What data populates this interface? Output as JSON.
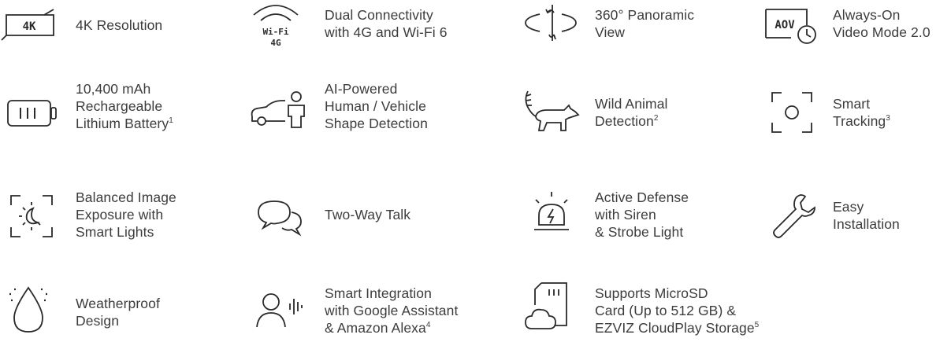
{
  "features": {
    "f1": {
      "icon": "4k-display-icon",
      "badge": "4K",
      "lines": [
        "4K Resolution"
      ]
    },
    "f2": {
      "icon": "wifi-4g-icon",
      "badge_top": "Wi-Fi",
      "badge_bottom": "4G",
      "lines": [
        "Dual Connectivity",
        "with 4G and Wi-Fi 6"
      ]
    },
    "f3": {
      "icon": "panorama-360-icon",
      "lines": [
        "360° Panoramic",
        "View"
      ]
    },
    "f4": {
      "icon": "aov-clock-icon",
      "badge": "AOV",
      "lines": [
        "Always-On",
        "Video Mode 2.0"
      ]
    },
    "f5": {
      "icon": "battery-icon",
      "lines": [
        "10,400 mAh",
        "Rechargeable",
        "Lithium Battery"
      ],
      "sup": "1"
    },
    "f6": {
      "icon": "car-person-icon",
      "lines": [
        "AI-Powered",
        "Human / Vehicle",
        "Shape Detection"
      ]
    },
    "f7": {
      "icon": "raccoon-icon",
      "lines": [
        "Wild Animal",
        "Detection"
      ],
      "sup": "2"
    },
    "f8": {
      "icon": "focus-frame-icon",
      "lines": [
        "Smart",
        "Tracking"
      ],
      "sup": "3"
    },
    "f9": {
      "icon": "sun-moon-frame-icon",
      "lines": [
        "Balanced Image",
        "Exposure with",
        "Smart Lights"
      ]
    },
    "f10": {
      "icon": "chat-bubbles-icon",
      "lines": [
        "Two-Way Talk"
      ]
    },
    "f11": {
      "icon": "siren-icon",
      "lines": [
        "Active Defense",
        "with Siren",
        "& Strobe Light"
      ]
    },
    "f12": {
      "icon": "wrench-icon",
      "lines": [
        "Easy",
        "Installation"
      ]
    },
    "f13": {
      "icon": "waterdrop-icon",
      "lines": [
        "Weatherproof",
        "Design"
      ]
    },
    "f14": {
      "icon": "voice-assistant-icon",
      "lines": [
        "Smart Integration",
        "with Google Assistant",
        "& Amazon Alexa"
      ],
      "sup": "4"
    },
    "f15": {
      "icon": "sdcard-cloud-icon",
      "lines": [
        "Supports MicroSD",
        "Card (Up to 512 GB) &",
        "EZVIZ CloudPlay Storage"
      ],
      "sup": "5"
    }
  },
  "colors": {
    "icon": "#2a2a2a",
    "text": "#3c3c3c",
    "background": "#ffffff"
  }
}
